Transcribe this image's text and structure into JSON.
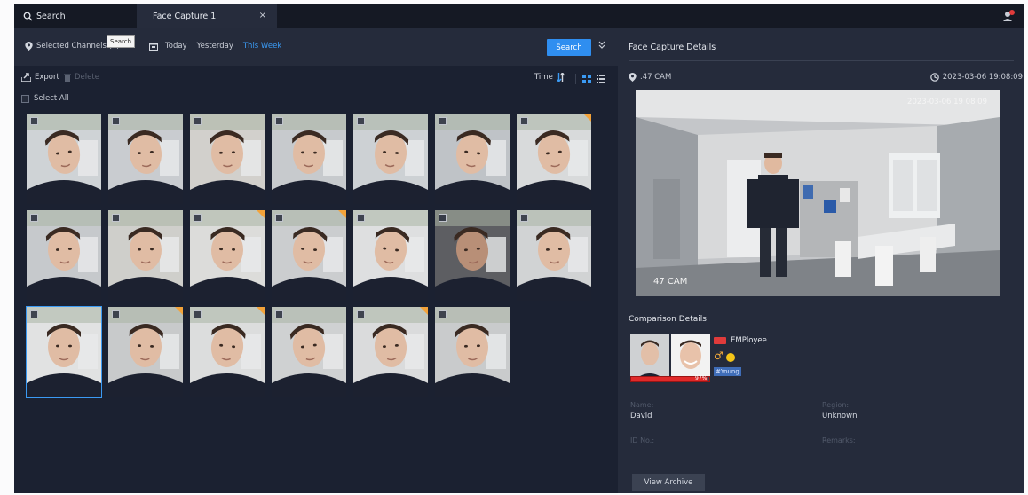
{
  "tabs": {
    "search_label": "Search",
    "face_label": "Face Capture 1",
    "close_glyph": "×"
  },
  "filter": {
    "channels_label": "Selected Channels (2)",
    "tooltip": "Search",
    "dates": [
      "Today",
      "Yesterday",
      "This Week"
    ],
    "active_date": "This Week",
    "search_button": "Search"
  },
  "toolbar": {
    "export": "Export",
    "delete": "Delete",
    "sort": "Time"
  },
  "select_all": "Select All",
  "thumbnails": [
    {
      "id": 1,
      "bg": "#cfd3d6",
      "corner": false
    },
    {
      "id": 2,
      "bg": "#c9ccd0",
      "corner": false
    },
    {
      "id": 3,
      "bg": "#d2d0cc",
      "corner": false
    },
    {
      "id": 4,
      "bg": "#c7cacd",
      "corner": false
    },
    {
      "id": 5,
      "bg": "#cdd1d4",
      "corner": false
    },
    {
      "id": 6,
      "bg": "#bfc3c7",
      "corner": false
    },
    {
      "id": 7,
      "bg": "#d8dadb",
      "corner": true
    },
    {
      "id": 8,
      "bg": "#c6c9cc",
      "corner": false
    },
    {
      "id": 9,
      "bg": "#cfcfcb",
      "corner": false
    },
    {
      "id": 10,
      "bg": "#dcdcda",
      "corner": true
    },
    {
      "id": 11,
      "bg": "#cbcdcf",
      "corner": true
    },
    {
      "id": 12,
      "bg": "#dedfe0",
      "corner": false
    },
    {
      "id": 13,
      "bg": "#5d5e62",
      "corner": false
    },
    {
      "id": 14,
      "bg": "#d1d3d4",
      "corner": false
    },
    {
      "id": 15,
      "bg": "#e1e2e2",
      "corner": false
    },
    {
      "id": 16,
      "bg": "#c8cacb",
      "corner": true
    },
    {
      "id": 17,
      "bg": "#dcdddd",
      "corner": true
    },
    {
      "id": 18,
      "bg": "#cfd1d2",
      "corner": false
    },
    {
      "id": 19,
      "bg": "#dadbdc",
      "corner": true
    },
    {
      "id": 20,
      "bg": "#c9cbcc",
      "corner": false
    }
  ],
  "details": {
    "title": "Face Capture Details",
    "camera": ".47 CAM",
    "time": "2023-03-06 19:08:09",
    "scene_timestamp": "2023-03-06 19 08 09",
    "scene_camera": "47 CAM"
  },
  "comparison": {
    "title": "Comparison Details",
    "group": "EMPloyee",
    "similarity": "97%",
    "similarity_value": 0.97,
    "age_tag": "#Young",
    "fields": {
      "name_label": "Name:",
      "name_value": "David",
      "region_label": "Region:",
      "region_value": "Unknown",
      "id_label": "ID No.:",
      "remarks_label": "Remarks:"
    },
    "archive_button": "View Archive"
  },
  "colors": {
    "accent": "#2f8ef0",
    "background": "#1d2230",
    "panel": "#252b3b",
    "corner_mark": "#f3a33a",
    "bar": "#e02a2a"
  }
}
